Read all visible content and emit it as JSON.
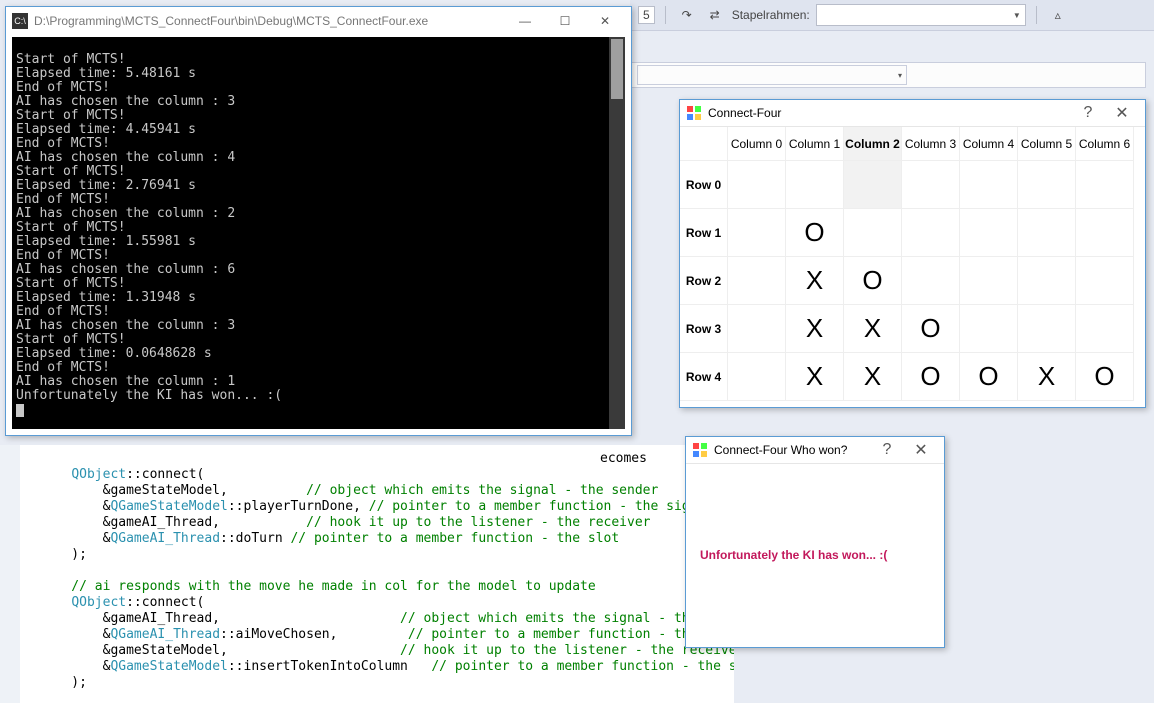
{
  "toolbar": {
    "stack_label": "Stapelrahmen:",
    "line_no": "5"
  },
  "console": {
    "title": "D:\\Programming\\MCTS_ConnectFour\\bin\\Debug\\MCTS_ConnectFour.exe",
    "lines": [
      "",
      "Start of MCTS!",
      "Elapsed time: 5.48161 s",
      "End of MCTS!",
      "AI has chosen the column : 3",
      "Start of MCTS!",
      "Elapsed time: 4.45941 s",
      "End of MCTS!",
      "AI has chosen the column : 4",
      "Start of MCTS!",
      "Elapsed time: 2.76941 s",
      "End of MCTS!",
      "AI has chosen the column : 2",
      "Start of MCTS!",
      "Elapsed time: 1.55981 s",
      "End of MCTS!",
      "AI has chosen the column : 6",
      "Start of MCTS!",
      "Elapsed time: 1.31948 s",
      "End of MCTS!",
      "AI has chosen the column : 3",
      "Start of MCTS!",
      "Elapsed time: 0.0648628 s",
      "End of MCTS!",
      "AI has chosen the column : 1",
      "Unfortunately the KI has won... :("
    ]
  },
  "board": {
    "title": "Connect-Four",
    "help": "?",
    "cols": [
      "Column 0",
      "Column 1",
      "Column 2",
      "Column 3",
      "Column 4",
      "Column 5",
      "Column 6"
    ],
    "rows": [
      "Row 0",
      "Row 1",
      "Row 2",
      "Row 3",
      "Row 4"
    ],
    "selected_col": 2,
    "grid": [
      [
        "",
        "",
        "",
        "",
        "",
        "",
        ""
      ],
      [
        "",
        "O",
        "",
        "",
        "",
        "",
        ""
      ],
      [
        "",
        "X",
        "O",
        "",
        "",
        "",
        ""
      ],
      [
        "",
        "X",
        "X",
        "O",
        "",
        "",
        ""
      ],
      [
        "",
        "X",
        "X",
        "O",
        "O",
        "X",
        "O"
      ]
    ]
  },
  "msgwin": {
    "title": "Connect-Four Who won?",
    "help": "?",
    "message": "Unfortunately the KI has won... :("
  },
  "code": {
    "frag_top": "ecomes",
    "l1a": "QObject",
    "l1b": "::connect(",
    "l2a": "        &gameStateModel,          ",
    "l2c": "// object which emits the signal - the sender",
    "l3a": "        &",
    "l3b": "QGameStateModel",
    "l3c": "::playerTurnDone, ",
    "l3d": "// pointer to a member function - the signal",
    "l4a": "        &gameAI_Thread,           ",
    "l4c": "// hook it up to the listener - the receiver",
    "l5a": "        &",
    "l5b": "QGameAI_Thread",
    "l5c": "::doTurn ",
    "l5d": "// pointer to a member function - the slot",
    "l6": "    );",
    "l7": "",
    "l8": "    // ai responds with the move he made in col for the model to update",
    "l9a": "QObject",
    "l9b": "::connect(",
    "l10a": "        &gameAI_Thread,                       ",
    "l10c": "// object which emits the signal - the sender",
    "l11a": "        &",
    "l11b": "QGameAI_Thread",
    "l11c": "::aiMoveChosen,         ",
    "l11d": "// pointer to a member function - the signal",
    "l12a": "        &gameStateModel,                      ",
    "l12c": "// hook it up to the listener - the receiver",
    "l13a": "        &",
    "l13b": "QGameStateModel",
    "l13c": "::insertTokenIntoColumn   ",
    "l13d": "// pointer to a member function - the slot",
    "l14": "    );"
  }
}
